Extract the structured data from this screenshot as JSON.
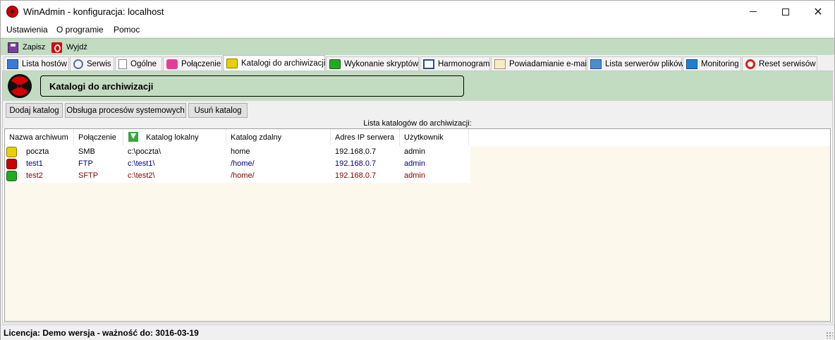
{
  "window": {
    "title": "WinAdmin - konfiguracja: localhost"
  },
  "menu": [
    "Ustawienia",
    "O programie",
    "Pomoc"
  ],
  "toolbar": {
    "save_label": "Zapisz",
    "exit_label": "Wyjdź"
  },
  "tabs": [
    {
      "label": "Lista hostów",
      "icon": "monitor-icon"
    },
    {
      "label": "Serwis",
      "icon": "gear-icon"
    },
    {
      "label": "Ogólne",
      "icon": "document-icon"
    },
    {
      "label": "Połączenie",
      "icon": "connection-icon"
    },
    {
      "label": "Katalogi do archiwizacji",
      "icon": "archive-cube-icon",
      "active": true
    },
    {
      "label": "Wykonanie skryptów",
      "icon": "script-cube-icon"
    },
    {
      "label": "Harmonogram",
      "icon": "calendar-icon"
    },
    {
      "label": "Powiadamianie e-mail",
      "icon": "envelope-icon"
    },
    {
      "label": "Lista serwerów plików",
      "icon": "servers-icon"
    },
    {
      "label": "Monitoring",
      "icon": "monitor-icon"
    },
    {
      "label": "Reset serwisów",
      "icon": "reset-icon"
    }
  ],
  "page": {
    "section_title": "Katalogi do archiwizacji",
    "buttons": {
      "add": "Dodaj katalog",
      "processes": "Obsługa procesów systemowych",
      "remove": "Usuń katalog"
    },
    "list_caption": "Lista katalogów do archiwizacji:"
  },
  "table": {
    "columns": [
      "Nazwa archiwum",
      "Połączenie",
      "Katalog lokalny",
      "Katalog zdalny",
      "Adres IP serwera",
      "Użytkownik"
    ],
    "rows": [
      {
        "name": "poczta",
        "connection": "SMB",
        "local": "c:\\poczta\\",
        "remote": "home",
        "ip": "192.168.0.7",
        "user": "admin",
        "color": "#000000",
        "icon_color": "#e8d000"
      },
      {
        "name": "test1",
        "connection": "FTP",
        "local": "c:\\test1\\",
        "remote": "/home/",
        "ip": "192.168.0.7",
        "user": "admin",
        "color": "#000080",
        "icon_color": "#cc0000"
      },
      {
        "name": "test2",
        "connection": "SFTP",
        "local": "c:\\test2\\",
        "remote": "/home/",
        "ip": "192.168.0.7",
        "user": "admin",
        "color": "#800000",
        "icon_color": "#22aa22"
      }
    ]
  },
  "status": {
    "text": "Licencja: Demo wersja - ważność do: 3016-03-19"
  }
}
